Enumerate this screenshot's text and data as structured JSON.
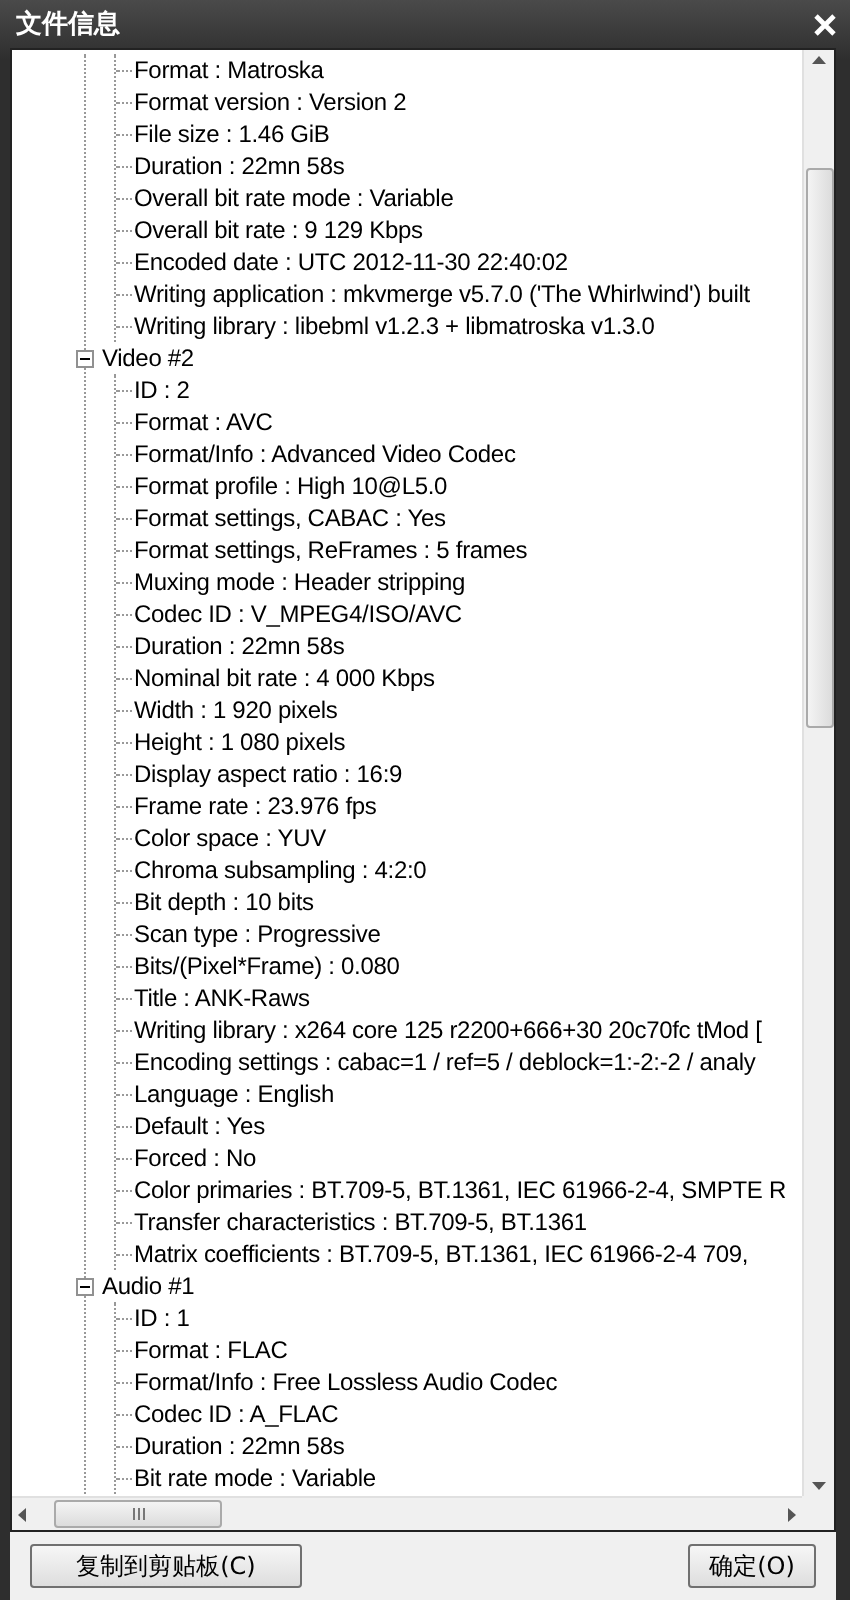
{
  "window": {
    "title": "文件信息"
  },
  "tree": {
    "partial_children": [
      "Format : Matroska",
      "Format version : Version 2",
      "File size : 1.46 GiB",
      "Duration : 22mn 58s",
      "Overall bit rate mode : Variable",
      "Overall bit rate : 9 129 Kbps",
      "Encoded date : UTC 2012-11-30 22:40:02",
      "Writing application : mkvmerge v5.7.0 ('The Whirlwind') built",
      "Writing library : libebml v1.2.3 + libmatroska v1.3.0"
    ],
    "groups": [
      {
        "label": "Video #2",
        "expanded": true,
        "children": [
          "ID : 2",
          "Format : AVC",
          "Format/Info : Advanced Video Codec",
          "Format profile : High 10@L5.0",
          "Format settings, CABAC : Yes",
          "Format settings, ReFrames : 5 frames",
          "Muxing mode : Header stripping",
          "Codec ID : V_MPEG4/ISO/AVC",
          "Duration : 22mn 58s",
          "Nominal bit rate : 4 000 Kbps",
          "Width : 1 920 pixels",
          "Height : 1 080 pixels",
          "Display aspect ratio : 16:9",
          "Frame rate : 23.976 fps",
          "Color space : YUV",
          "Chroma subsampling : 4:2:0",
          "Bit depth : 10 bits",
          "Scan type : Progressive",
          "Bits/(Pixel*Frame) : 0.080",
          "Title : ANK-Raws",
          "Writing library : x264 core 125 r2200+666+30 20c70fc tMod [",
          "Encoding settings : cabac=1 / ref=5 / deblock=1:-2:-2 / analy",
          "Language : English",
          "Default : Yes",
          "Forced : No",
          "Color primaries : BT.709-5, BT.1361, IEC 61966-2-4, SMPTE R",
          "Transfer characteristics : BT.709-5, BT.1361",
          "Matrix coefficients : BT.709-5, BT.1361, IEC 61966-2-4 709,"
        ]
      },
      {
        "label": "Audio #1",
        "expanded": true,
        "children": [
          "ID : 1",
          "Format : FLAC",
          "Format/Info : Free Lossless Audio Codec",
          "Codec ID : A_FLAC",
          "Duration : 22mn 58s",
          "Bit rate mode : Variable"
        ]
      }
    ]
  },
  "buttons": {
    "copy": "复制到剪贴板(C)",
    "ok": "确定(O)"
  }
}
